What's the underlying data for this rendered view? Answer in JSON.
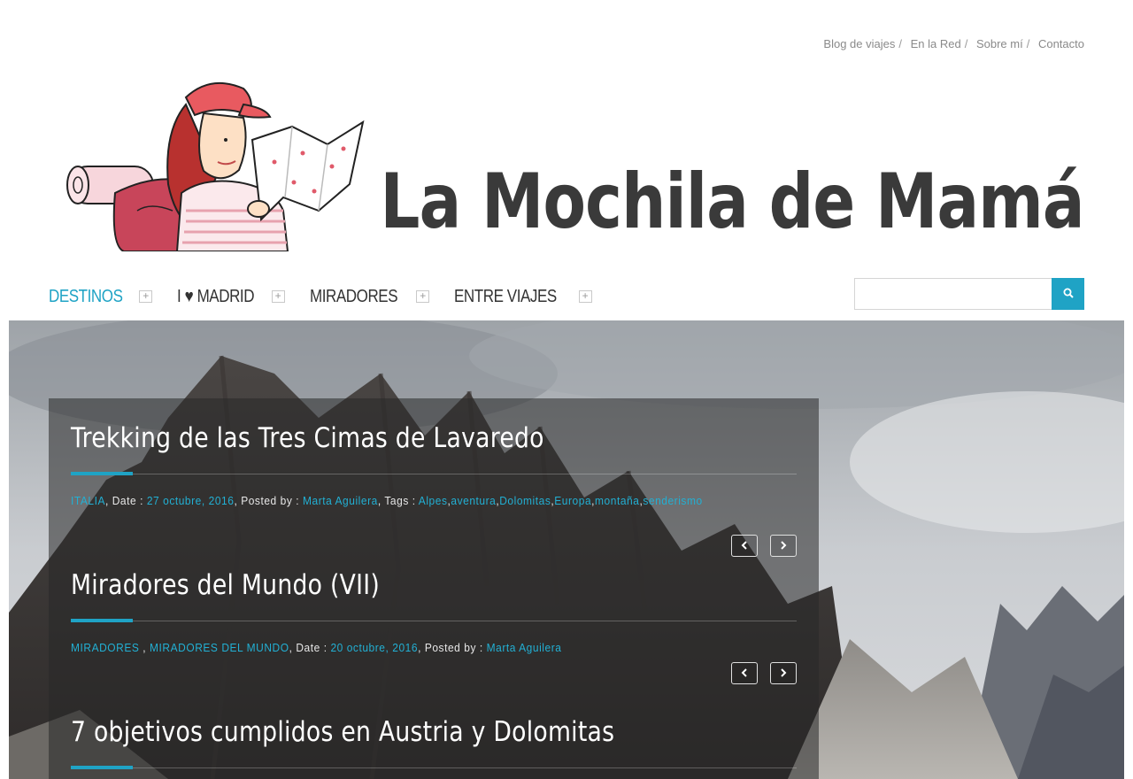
{
  "top_links": [
    {
      "label": "Blog de viajes"
    },
    {
      "label": "En la Red"
    },
    {
      "label": "Sobre mí"
    },
    {
      "label": "Contacto"
    }
  ],
  "top_links_separator": "/",
  "site_title": "La Mochila de Mamá",
  "nav": [
    {
      "label": "DESTINOS",
      "active": true
    },
    {
      "label": "I ♥ MADRID",
      "active": false
    },
    {
      "label": "MIRADORES",
      "active": false
    },
    {
      "label": "ENTRE VIAJES",
      "active": false
    }
  ],
  "nav_expand_symbol": "+",
  "search": {
    "value": "",
    "placeholder": "",
    "icon": "search-icon"
  },
  "colors": {
    "accent": "#1fa3c5",
    "title": "#3a3a3a"
  },
  "posts": [
    {
      "title": "Trekking de las Tres Cimas de Lavaredo",
      "categories": [
        "ITALIA"
      ],
      "date_label": ", Date : ",
      "date": "27 octubre, 2016",
      "posted_label": ", Posted by : ",
      "author": "Marta Aguilera",
      "tags_label": ", Tags : ",
      "tags": [
        "Alpes",
        "aventura",
        "Dolomitas",
        "Europa",
        "montaña",
        "senderismo"
      ]
    },
    {
      "title": "Miradores del Mundo (VII)",
      "categories": [
        "MIRADORES",
        "MIRADORES DEL MUNDO"
      ],
      "date_label": ", Date : ",
      "date": "20 octubre, 2016",
      "posted_label": ", Posted by : ",
      "author": "Marta Aguilera"
    },
    {
      "title": "7 objetivos cumplidos en Austria y Dolomitas"
    }
  ],
  "arrows": {
    "prev": "chevron-left-icon",
    "next": "chevron-right-icon"
  }
}
